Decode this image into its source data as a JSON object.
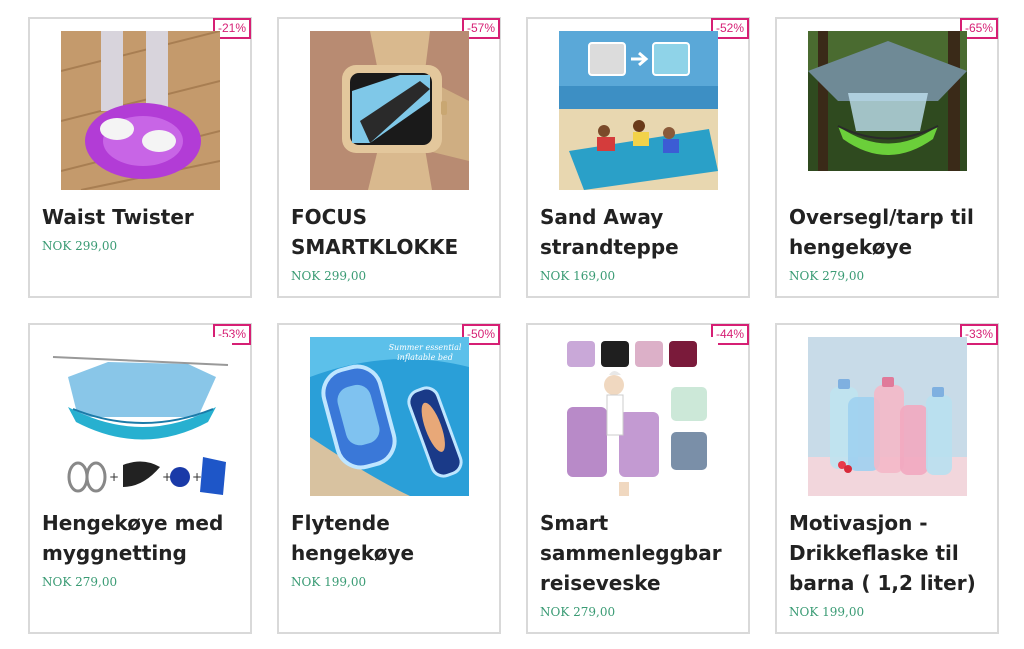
{
  "products": [
    {
      "title": "Waist Twister",
      "price": "NOK 299,00",
      "discount": "-21%",
      "image": "waist-twister-image"
    },
    {
      "title": "FOCUS SMARTKLOKKE",
      "price": "NOK 299,00",
      "discount": "-57%",
      "image": "smartwatch-image"
    },
    {
      "title": "Sand Away strandteppe",
      "price": "NOK 169,00",
      "discount": "-52%",
      "image": "beach-blanket-image"
    },
    {
      "title": "Oversegl/tarp til hengekøye",
      "price": "NOK 279,00",
      "discount": "-65%",
      "image": "tarp-hammock-image"
    },
    {
      "title": "Hengekøye med myggnetting",
      "price": "NOK 279,00",
      "discount": "-53%",
      "image": "hammock-net-image"
    },
    {
      "title": "Flytende hengekøye",
      "price": "NOK 199,00",
      "discount": "-50%",
      "image": "floating-hammock-image",
      "image_caption": "Summer essential inflatable bed"
    },
    {
      "title": "Smart sammenleggbar reiseveske",
      "price": "NOK 279,00",
      "discount": "-44%",
      "image": "travel-bag-image"
    },
    {
      "title": "Motivasjon - Drikkeflaske til barna ( 1,2 liter)",
      "price": "NOK 199,00",
      "discount": "-33%",
      "image": "water-bottle-image"
    }
  ],
  "colors": {
    "badge": "#d61f74",
    "price": "#3a9b74",
    "title": "#222222",
    "border": "#d9d9d9"
  }
}
